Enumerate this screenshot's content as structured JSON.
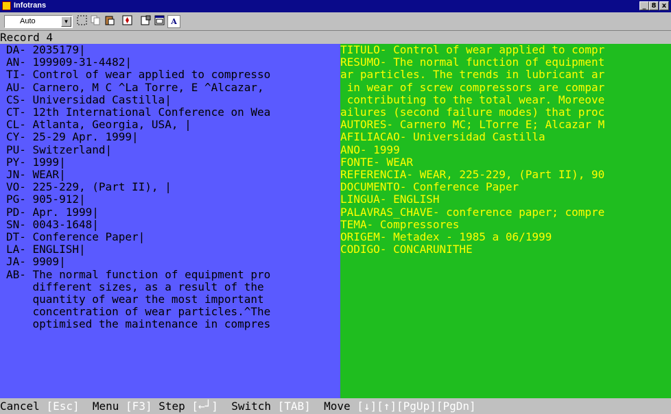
{
  "window": {
    "title": "Infotrans",
    "controls": [
      "_",
      "8",
      "x"
    ]
  },
  "toolbar": {
    "font_combo_value": "Auto",
    "letter_button": "A"
  },
  "record_label": "Record 4",
  "left_lines": [
    "DA- 2035179|",
    "AN- 199909-31-4482|",
    "TI- Control of wear applied to compresso",
    "AU- Carnero, M C ^La Torre, E ^Alcazar,",
    "CS- Universidad Castilla|",
    "CT- 12th International Conference on Wea",
    "CL- Atlanta, Georgia, USA, |",
    "CY- 25-29 Apr. 1999|",
    "PU- Switzerland|",
    "PY- 1999|",
    "JN- WEAR|",
    "VO- 225-229, (Part II), |",
    "PG- 905-912|",
    "PD- Apr. 1999|",
    "SN- 0043-1648|",
    "DT- Conference Paper|",
    "LA- ENGLISH|",
    "JA- 9909|",
    "AB- The normal function of equipment pro",
    "    different sizes, as a result of the",
    "    quantity of wear the most important",
    "    concentration of wear particles.^The",
    "    optimised the maintenance in compres"
  ],
  "right_lines": [
    "TITULO- Control of wear applied to compr",
    "RESUMO- The normal function of equipment",
    "ar particles. The trends in lubricant ar",
    " in wear of screw compressors are compar",
    " contributing to the total wear. Moreove",
    "ailures (second failure modes) that proc",
    "AUTORES- Carnero MC; LTorre E; Alcazar M",
    "AFILIACAO- Universidad Castilla",
    "ANO- 1999",
    "FONTE- WEAR",
    "REFERENCIA- WEAR, 225-229, (Part II), 90",
    "DOCUMENTO- Conference Paper",
    "LINGUA- ENGLISH",
    "PALAVRAS_CHAVE- conference paper; compre",
    "TEMA- Compressores",
    "ORIGEM- Metadex - 1985 a 06/1999",
    "CODIGO- CONCARUNITHE"
  ],
  "status": {
    "cancel": "Cancel",
    "cancel_key": "[Esc]",
    "menu": "Menu",
    "menu_key": "[F3]",
    "step": "Step",
    "step_key": "[←┘]",
    "switch": "Switch",
    "switch_key": "[TAB]",
    "move": "Move",
    "move_keys": "[↓][↑][PgUp][PgDn]"
  },
  "colors": {
    "left_bg": "#5a5aff",
    "right_bg": "#1fbd1f",
    "right_text": "#ffff00",
    "status_key": "#ffffff"
  }
}
